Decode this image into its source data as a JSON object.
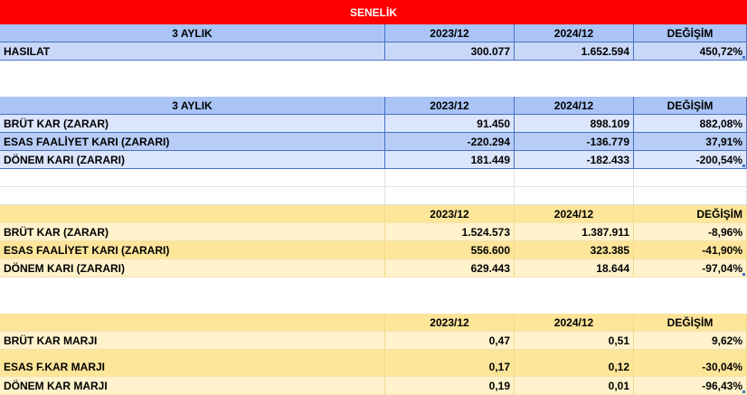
{
  "title": "SENELİK",
  "table1": {
    "header": [
      "3 AYLIK",
      "2023/12",
      "2024/12",
      "DEĞİŞİM"
    ],
    "rows": [
      [
        "HASILAT",
        "300.077",
        "1.652.594",
        "450,72%"
      ]
    ]
  },
  "table2": {
    "header": [
      "3 AYLIK",
      "2023/12",
      "2024/12",
      "DEĞİŞİM"
    ],
    "rows": [
      [
        "BRÜT KAR (ZARAR)",
        "91.450",
        "898.109",
        "882,08%"
      ],
      [
        "ESAS FAALİYET KARI (ZARARI)",
        "-220.294",
        "-136.779",
        "37,91%"
      ],
      [
        "DÖNEM KARI (ZARARI)",
        "181.449",
        "-182.433",
        "-200,54%"
      ]
    ]
  },
  "table3": {
    "header": [
      "",
      "2023/12",
      "2024/12",
      "DEĞİŞİM"
    ],
    "rows": [
      [
        "BRÜT KAR (ZARAR)",
        "1.524.573",
        "1.387.911",
        "-8,96%"
      ],
      [
        "ESAS FAALİYET KARI (ZARARI)",
        "556.600",
        "323.385",
        "-41,90%"
      ],
      [
        "DÖNEM KARI (ZARARI)",
        "629.443",
        "18.644",
        "-97,04%"
      ]
    ]
  },
  "table4": {
    "header": [
      "",
      "2023/12",
      "2024/12",
      "DEĞİŞİM"
    ],
    "rows": [
      [
        "BRÜT KAR MARJI",
        "0,47",
        "0,51",
        "9,62%"
      ],
      [
        "ESAS F.KAR MARJI",
        "0,17",
        "0,12",
        "-30,04%"
      ],
      [
        "DÖNEM KAR MARJI",
        "0,19",
        "0,01",
        "-96,43%"
      ]
    ]
  },
  "colors": {
    "title_bg": "#ff0000",
    "blue_header": "#a9c4f5",
    "blue_row": "#dbe5fb",
    "yellow_header": "#fde59a",
    "yellow_row": "#fff2cc"
  }
}
